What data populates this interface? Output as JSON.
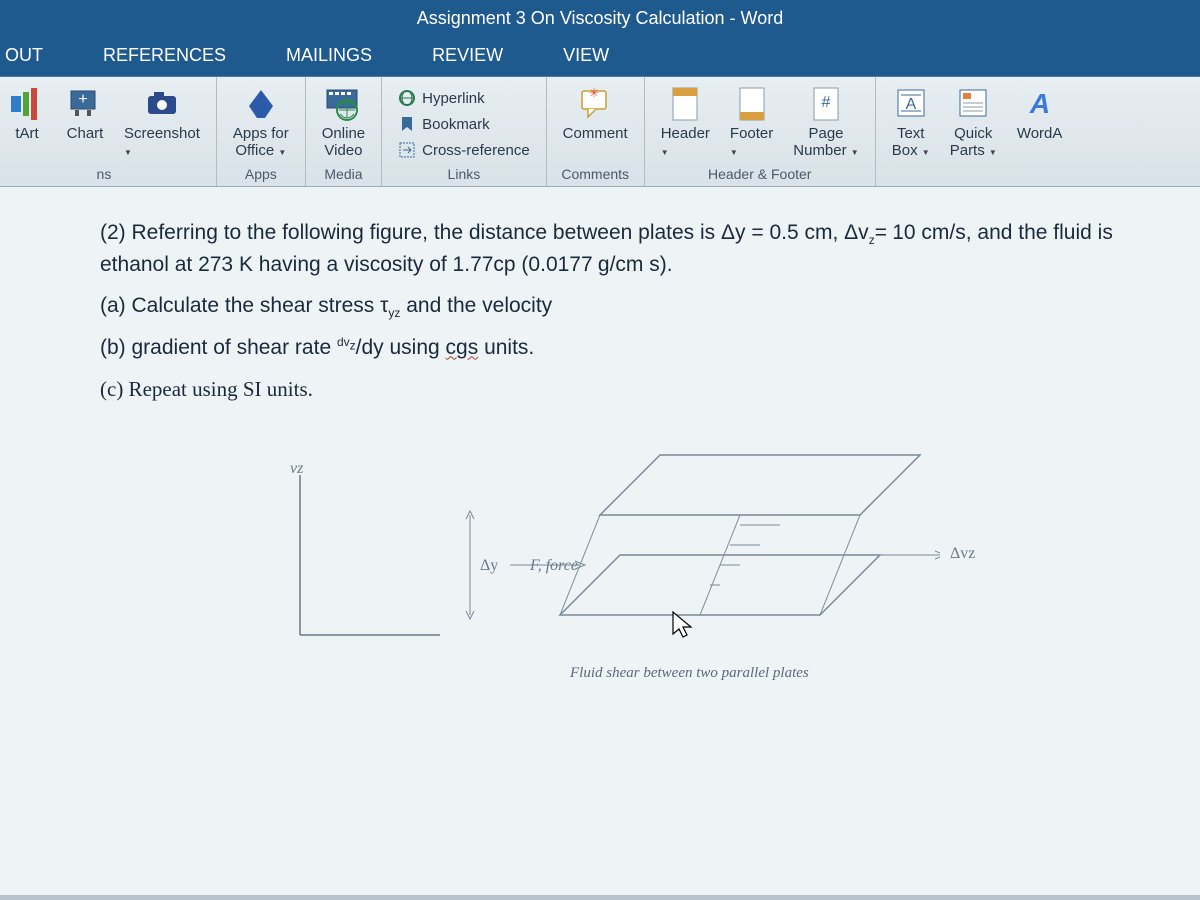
{
  "title": "Assignment 3 On Viscosity Calculation - Word",
  "tabs": {
    "out": "OUT",
    "references": "REFERENCES",
    "mailings": "MAILINGS",
    "review": "REVIEW",
    "view": "VIEW"
  },
  "ribbon": {
    "illustrations": {
      "smartart": "tArt",
      "chart": "Chart",
      "screenshot": "Screenshot",
      "group": "ns"
    },
    "apps": {
      "btn1": "Apps for",
      "btn2": "Office",
      "group": "Apps"
    },
    "media": {
      "btn1": "Online",
      "btn2": "Video",
      "group": "Media"
    },
    "links": {
      "hyperlink": "Hyperlink",
      "bookmark": "Bookmark",
      "crossref": "Cross-reference",
      "group": "Links"
    },
    "comments": {
      "btn": "Comment",
      "group": "Comments"
    },
    "headerfooter": {
      "header": "Header",
      "footer": "Footer",
      "page1": "Page",
      "page2": "Number",
      "group": "Header & Footer"
    },
    "text": {
      "textbox1": "Text",
      "textbox2": "Box",
      "quick1": "Quick",
      "quick2": "Parts",
      "worda": "WordA",
      "a": "A"
    }
  },
  "doc": {
    "p1a": "(2) Referring to the following figure, the distance between plates is Δy = 0.5 cm, Δv",
    "p1b": "=",
    "p2": "10 cm/s, and the fluid is ethanol at 273 K having a viscosity of 1.77cp (0.0177",
    "p3": "g/cm s).",
    "p4a": "(a)  Calculate the shear stress τ",
    "p4b": " and the velocity",
    "p5a": "(b)   gradient of shear rate ",
    "p5b": "/dy using ",
    "p5c": " units.",
    "p5w": "cgs",
    "p5sup": "dv",
    "p5supz": "z",
    "p6": "(c) Repeat using SI units.",
    "sub_yz": "yz",
    "sub_z": "z"
  },
  "fig": {
    "dy": "Δy",
    "force": "F, force",
    "dvz": "Δvz",
    "vz": "vz",
    "caption": "Fluid shear between two parallel plates"
  }
}
